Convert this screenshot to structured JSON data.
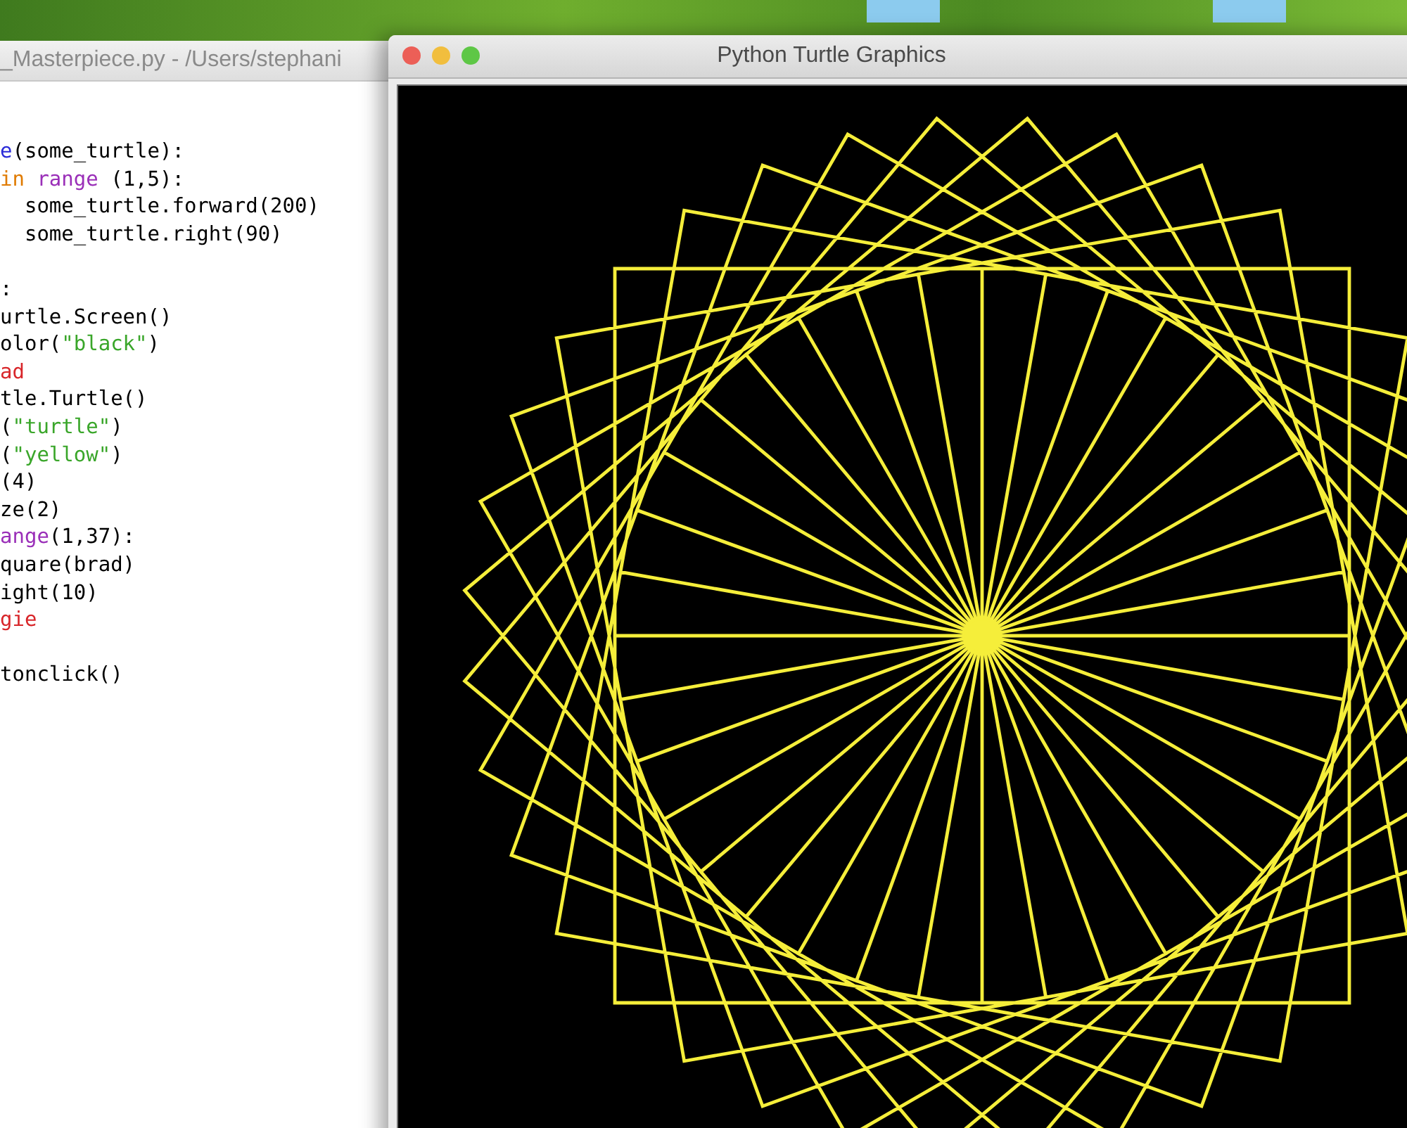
{
  "editor": {
    "title": "_Masterpiece.py - /Users/stephani",
    "lines": [
      {
        "kind": "code",
        "segments": [
          {
            "text": "e",
            "kind": "def"
          },
          {
            "text": "(some_turtle):",
            "kind": "plain"
          }
        ]
      },
      {
        "kind": "code",
        "segments": [
          {
            "text": "in",
            "kind": "keyword"
          },
          {
            "text": " range",
            "kind": "builtin"
          },
          {
            "text": " (1,5):",
            "kind": "plain"
          }
        ]
      },
      {
        "kind": "code",
        "segments": [
          {
            "text": "  some_turtle.forward(200)",
            "kind": "plain"
          }
        ]
      },
      {
        "kind": "code",
        "segments": [
          {
            "text": "  some_turtle.right(90)",
            "kind": "plain"
          }
        ]
      },
      {
        "kind": "blank"
      },
      {
        "kind": "code",
        "segments": [
          {
            "text": ":",
            "kind": "plain"
          }
        ]
      },
      {
        "kind": "code",
        "segments": [
          {
            "text": "urtle.Screen()",
            "kind": "plain"
          }
        ]
      },
      {
        "kind": "code",
        "segments": [
          {
            "text": "olor(",
            "kind": "plain"
          },
          {
            "text": "\"black\"",
            "kind": "string"
          },
          {
            "text": ")",
            "kind": "plain"
          }
        ]
      },
      {
        "kind": "code",
        "segments": [
          {
            "text": "ad",
            "kind": "name"
          }
        ]
      },
      {
        "kind": "code",
        "segments": [
          {
            "text": "tle.Turtle()",
            "kind": "plain"
          }
        ]
      },
      {
        "kind": "code",
        "segments": [
          {
            "text": "(",
            "kind": "plain"
          },
          {
            "text": "\"turtle\"",
            "kind": "string"
          },
          {
            "text": ")",
            "kind": "plain"
          }
        ]
      },
      {
        "kind": "code",
        "segments": [
          {
            "text": "(",
            "kind": "plain"
          },
          {
            "text": "\"yellow\"",
            "kind": "string"
          },
          {
            "text": ")",
            "kind": "plain"
          }
        ]
      },
      {
        "kind": "code",
        "segments": [
          {
            "text": "(4)",
            "kind": "plain"
          }
        ]
      },
      {
        "kind": "code",
        "segments": [
          {
            "text": "ze(2)",
            "kind": "plain"
          }
        ]
      },
      {
        "kind": "code",
        "segments": [
          {
            "text": "ange",
            "kind": "builtin"
          },
          {
            "text": "(1,37):",
            "kind": "plain"
          }
        ]
      },
      {
        "kind": "code",
        "segments": [
          {
            "text": "quare(brad)",
            "kind": "plain"
          }
        ]
      },
      {
        "kind": "code",
        "segments": [
          {
            "text": "ight(10)",
            "kind": "plain"
          }
        ]
      },
      {
        "kind": "code",
        "segments": [
          {
            "text": "gie",
            "kind": "name"
          }
        ]
      },
      {
        "kind": "blank"
      },
      {
        "kind": "code",
        "segments": [
          {
            "text": "tonclick()",
            "kind": "plain"
          }
        ]
      }
    ]
  },
  "turtle_window": {
    "title": "Python Turtle Graphics"
  }
}
